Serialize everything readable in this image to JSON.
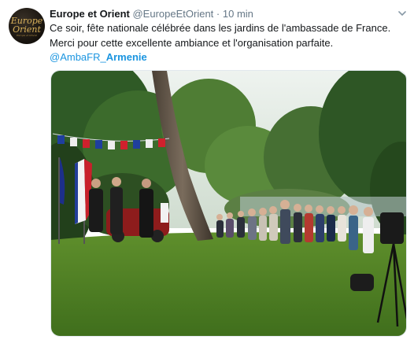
{
  "tweet": {
    "author_name": "Europe et Orient",
    "author_handle": "@EuropeEtOrient",
    "separator": "·",
    "time": "10 min",
    "text_line_1": "Ce soir, fête nationale célébrée dans les jardins de l'ambassade de France.",
    "text_line_2": "Merci pour cette excellente ambiance et l'organisation parfaite.",
    "mention": "@AmbaFR_",
    "hashtag": "Armenie"
  },
  "avatar": {
    "logo_line_1": "Europe",
    "logo_line_2": "Orient",
    "logo_line_3": "Europe et Orient"
  },
  "icons": {
    "menu": "chevron-down-icon"
  },
  "colors": {
    "link": "#1b95e0",
    "meta": "#657786",
    "text": "#14171a"
  }
}
